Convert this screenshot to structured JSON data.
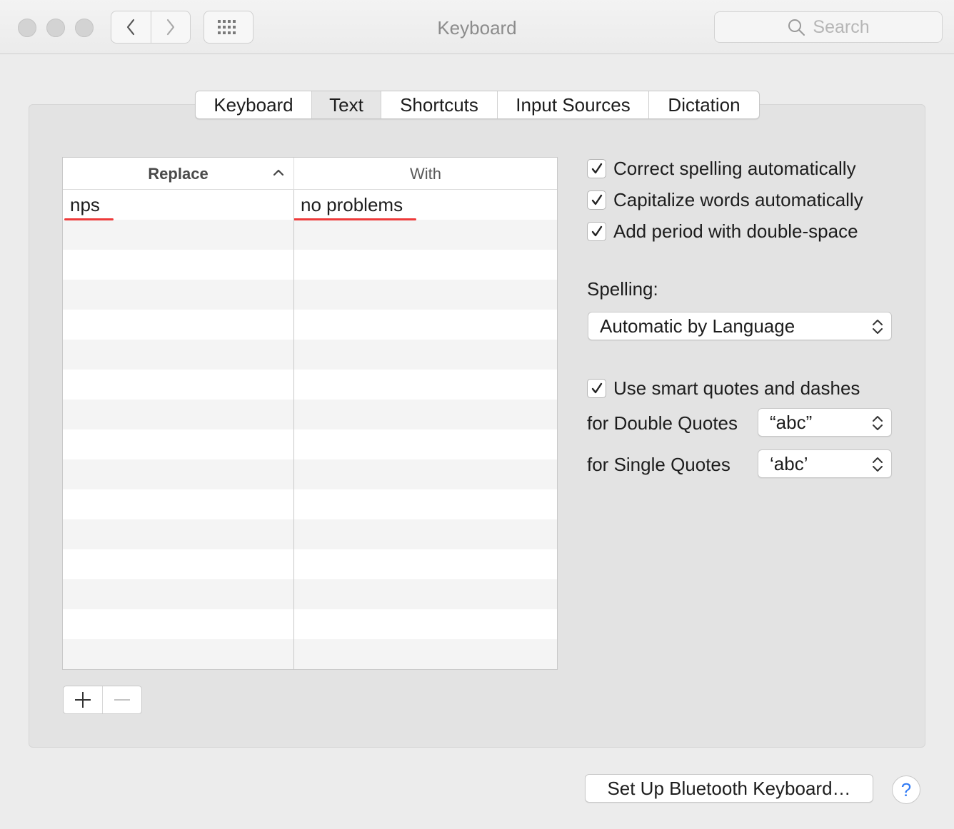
{
  "window": {
    "title": "Keyboard",
    "search_placeholder": "Search"
  },
  "tabs": [
    {
      "label": "Keyboard",
      "selected": false
    },
    {
      "label": "Text",
      "selected": true
    },
    {
      "label": "Shortcuts",
      "selected": false
    },
    {
      "label": "Input Sources",
      "selected": false
    },
    {
      "label": "Dictation",
      "selected": false
    }
  ],
  "table": {
    "columns": [
      "Replace",
      "With"
    ],
    "rows": [
      {
        "replace": "nps",
        "with": "no problems"
      }
    ]
  },
  "options": {
    "correct_spelling": {
      "label": "Correct spelling automatically",
      "checked": true
    },
    "capitalize_words": {
      "label": "Capitalize words automatically",
      "checked": true
    },
    "double_space_period": {
      "label": "Add period with double-space",
      "checked": true
    },
    "spelling_label": "Spelling:",
    "spelling_value": "Automatic by Language",
    "smart_quotes": {
      "label": "Use smart quotes and dashes",
      "checked": true
    },
    "double_quotes_label": "for Double Quotes",
    "double_quotes_value": "“abc”",
    "single_quotes_label": "for Single Quotes",
    "single_quotes_value": "‘abc’"
  },
  "buttons": {
    "bluetooth": "Set Up Bluetooth Keyboard…",
    "help": "?"
  },
  "colors": {
    "accent_underline": "#ee3a3a",
    "help_blue": "#2f7af5"
  }
}
